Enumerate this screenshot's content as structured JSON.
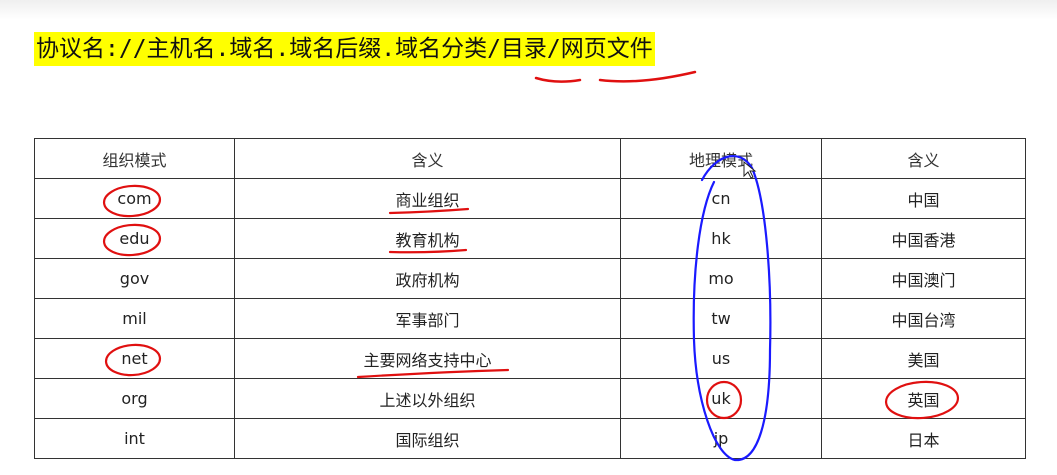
{
  "url_pattern": {
    "text": "协议名://主机名.域名.域名后缀.域名分类/目录/网页文件",
    "highlight_color": "#ffff00"
  },
  "table": {
    "headers": [
      "组织模式",
      "含义",
      "地理模式",
      "含义"
    ],
    "rows": [
      [
        "com",
        "商业组织",
        "cn",
        "中国"
      ],
      [
        "edu",
        "教育机构",
        "hk",
        "中国香港"
      ],
      [
        "gov",
        "政府机构",
        "mo",
        "中国澳门"
      ],
      [
        "mil",
        "军事部门",
        "tw",
        "中国台湾"
      ],
      [
        "net",
        "主要网络支持中心",
        "us",
        "美国"
      ],
      [
        "org",
        "上述以外组织",
        "uk",
        "英国"
      ],
      [
        "int",
        "国际组织",
        "jp",
        "日本"
      ]
    ]
  },
  "annotations": {
    "red_color": "#e01010",
    "blue_color": "#1a1aff",
    "red_circled": [
      "com",
      "edu",
      "net",
      "uk",
      "英国"
    ],
    "red_underlined": [
      "商业组织",
      "教育机构",
      "主要网络支持中心",
      "目录",
      "网页文件"
    ],
    "blue_outlined_column": "地理模式"
  }
}
